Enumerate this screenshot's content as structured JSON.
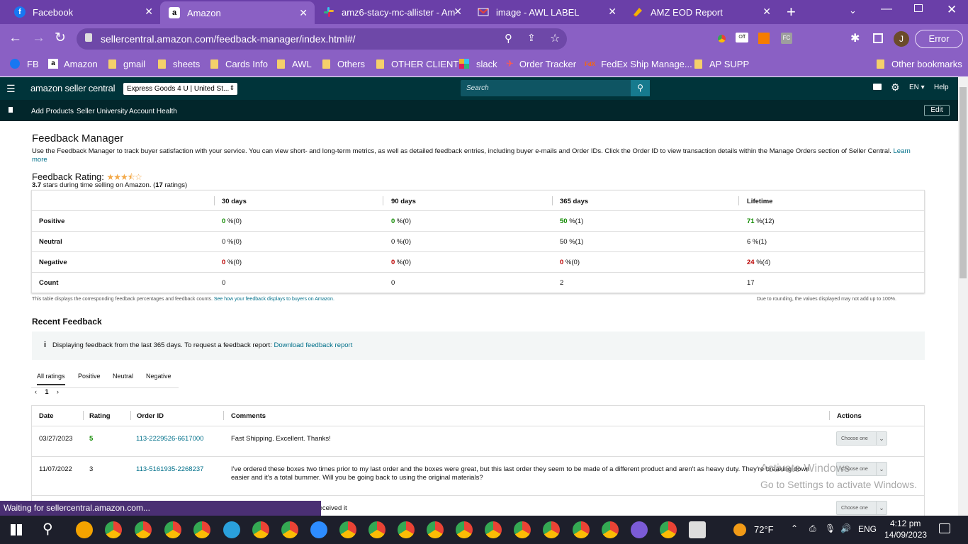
{
  "browser": {
    "tabs": [
      {
        "label": "Facebook",
        "icon": "facebook-icon"
      },
      {
        "label": "Amazon",
        "icon": "amazon-icon",
        "active": true
      },
      {
        "label": "amz6-stacy-mc-allister - Ama",
        "icon": "slack-icon"
      },
      {
        "label": "image - AWL LABEL",
        "icon": "gmail-icon"
      },
      {
        "label": "AMZ EOD Report",
        "icon": "sheets-icon"
      }
    ],
    "url": "sellercentral.amazon.com/feedback-manager/index.html#/",
    "error_label": "Error",
    "profile_initial": "J",
    "bookmarks": [
      "FB",
      "Amazon",
      "gmail",
      "sheets",
      "Cards Info",
      "AWL",
      "Others",
      "OTHER CLIENT",
      "slack",
      "Order Tracker",
      "FedEx Ship Manage...",
      "AP SUPP"
    ],
    "other_bookmarks": "Other bookmarks",
    "status_text": "Waiting for sellercentral.amazon.com..."
  },
  "seller": {
    "logo": "amazon seller central",
    "store": "Express Goods 4 U | United St...",
    "search_placeholder": "Search",
    "lang": "EN",
    "help": "Help",
    "nav": [
      "Add Products",
      "Seller University",
      "Account Health"
    ],
    "edit": "Edit"
  },
  "page": {
    "title": "Feedback Manager",
    "description": "Use the Feedback Manager to track buyer satisfaction with your service. You can view short- and long-term metrics, as well as detailed feedback entries, including buyer e-mails and Order IDs. Click the Order ID to view transaction details within the Manage Orders section of Seller Central.",
    "learn_more": "Learn more",
    "rating_label": "Feedback Rating:",
    "rating_value": "3.7",
    "rating_text_a": "stars during time selling on Amazon. (",
    "rating_count": "17",
    "rating_text_b": "ratings)",
    "stars": 3.7,
    "table_headers": [
      "30 days",
      "90 days",
      "365 days",
      "Lifetime"
    ],
    "rows": [
      {
        "label": "Positive",
        "cells": [
          {
            "v": "0",
            "r": " %(0)"
          },
          {
            "v": "0",
            "r": " %(0)"
          },
          {
            "v": "50",
            "r": " %(1)"
          },
          {
            "v": "71",
            "r": " %(12)"
          }
        ]
      },
      {
        "label": "Neutral",
        "cells": [
          {
            "v": "0",
            "r": " %(0)"
          },
          {
            "v": "0",
            "r": " %(0)"
          },
          {
            "v": "50",
            "r": " %(1)"
          },
          {
            "v": "6",
            "r": " %(1)"
          }
        ]
      },
      {
        "label": "Negative",
        "cells": [
          {
            "v": "0",
            "r": " %(0)"
          },
          {
            "v": "0",
            "r": " %(0)"
          },
          {
            "v": "0",
            "r": " %(0)"
          },
          {
            "v": "24",
            "r": " %(4)"
          }
        ]
      },
      {
        "label": "Count",
        "cells": [
          {
            "v": "0",
            "r": ""
          },
          {
            "v": "0",
            "r": ""
          },
          {
            "v": "2",
            "r": ""
          },
          {
            "v": "17",
            "r": ""
          }
        ]
      }
    ],
    "footnote_left": "This table displays the corresponding feedback percentages and feedback counts.",
    "footnote_link": "See how your feedback displays to buyers on Amazon.",
    "footnote_right": "Due to rounding, the values displayed may not add up to 100%.",
    "recent_title": "Recent Feedback",
    "info_text": "Displaying feedback from the last 365 days. To request a feedback report:",
    "info_link": "Download feedback report",
    "filter_tabs": [
      "All ratings",
      "Positive",
      "Neutral",
      "Negative"
    ],
    "page_num": "1",
    "feedback_headers": [
      "Date",
      "Rating",
      "Order ID",
      "Comments",
      "Actions"
    ],
    "feedback_rows": [
      {
        "date": "03/27/2023",
        "rating": "5",
        "order": "113-2229526-6617000",
        "comment": "Fast Shipping. Excellent. Thanks!",
        "action": "Choose one"
      },
      {
        "date": "11/07/2022",
        "rating": "3",
        "order": "113-5161935-2268237",
        "comment": "I've ordered these boxes two times prior to my last order and the boxes were great, but this last order they seem to be made of a different product and aren't as heavy duty. They're breaking down easier and it's a total bummer. Will you be going back to using the original materials?",
        "action": "Choose one"
      },
      {
        "date": "",
        "rating": "",
        "order": "",
        "comment": "m is running late. But I have received it",
        "action": "Choose one"
      }
    ],
    "watermark_1": "Activate Windows",
    "watermark_2": "Go to Settings to activate Windows."
  },
  "taskbar": {
    "weather": "72°F",
    "lang": "ENG",
    "time": "4:12 pm",
    "date": "14/09/2023"
  }
}
